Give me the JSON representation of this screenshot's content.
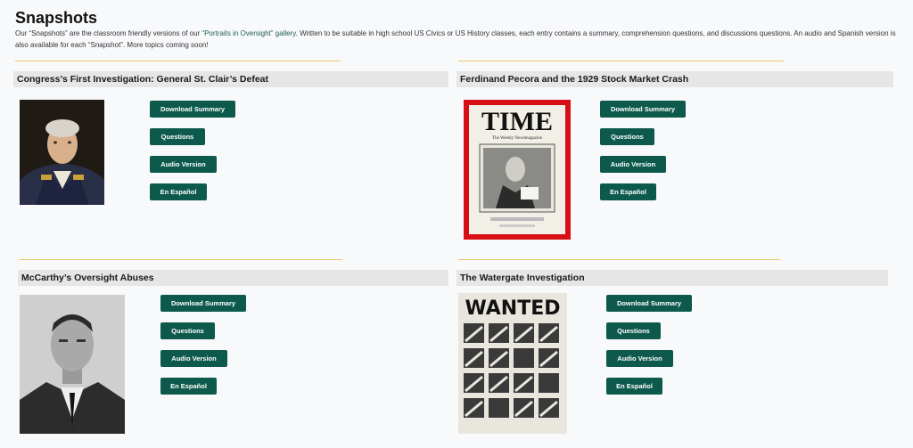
{
  "page": {
    "title": "Snapshots",
    "intro_before": "Our “Snapshots” are the classroom friendly versions of our ",
    "intro_link": "“Portraits in Oversight” gallery",
    "intro_after": ". Written to be suitable in high school US Civics or US History classes, each entry contains a summary, comprehension questions, and discussions questions. An audio and Spanish version is also available for each “Snapshot”. More topics coming soon!"
  },
  "colors": {
    "button_bg": "#0d5a4c",
    "divider": "#e8c766",
    "title_bar": "#e6e6e6",
    "link": "#1b5e4a",
    "time_border": "#d90f16"
  },
  "cards": [
    {
      "title": "Congress’s First Investigation: General St. Clair’s Defeat",
      "image": "portrait-painting-image",
      "buttons": [
        "Download Summary",
        "Questions",
        "Audio Version",
        "En Español"
      ]
    },
    {
      "title": "Ferdinand Pecora and the 1929 Stock Market Crash",
      "image": "time-magazine-cover-image",
      "image_text": {
        "masthead": "TIME",
        "subtitle": "The Weekly Newsmagazine"
      },
      "buttons": [
        "Download Summary",
        "Questions",
        "Audio Version",
        "En Español"
      ]
    },
    {
      "title": "McCarthy’s Oversight Abuses",
      "image": "bw-portrait-photo-image",
      "buttons": [
        "Download Summary",
        "Questions",
        "Audio Version",
        "En Español"
      ]
    },
    {
      "title": "The Watergate Investigation",
      "image": "wanted-poster-image",
      "image_text": {
        "headline": "WANTED"
      },
      "buttons": [
        "Download Summary",
        "Questions",
        "Audio Version",
        "En Español"
      ]
    }
  ]
}
